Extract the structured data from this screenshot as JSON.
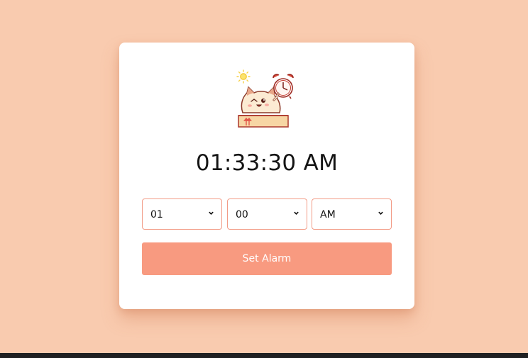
{
  "clock": {
    "current_time": "01:33:30 AM"
  },
  "alarm": {
    "hour": "01",
    "minute": "00",
    "period": "AM",
    "set_button_label": "Set Alarm"
  },
  "colors": {
    "background": "#f9cbaf",
    "accent": "#f89a80",
    "card": "#ffffff"
  }
}
